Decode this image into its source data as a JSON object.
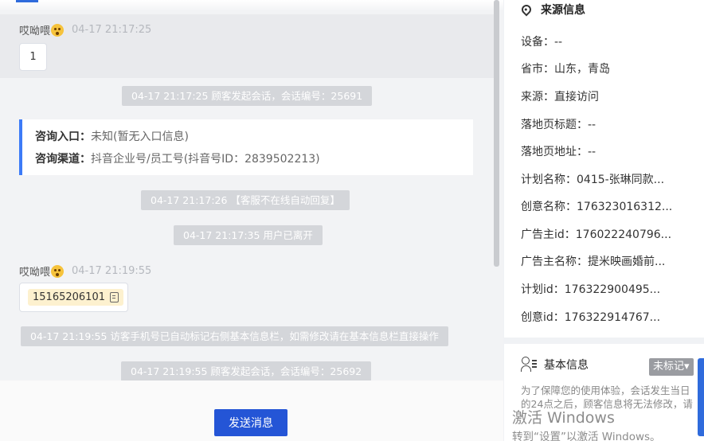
{
  "chat": {
    "messages": [
      {
        "sender": "哎呦喂",
        "time": "04-17 21:17:25",
        "content": "1"
      },
      {
        "sender": "哎呦喂",
        "time": "04-17 21:19:55",
        "content": "15165206101"
      }
    ],
    "system": [
      "04-17 21:17:25 顾客发起会话，会话编号：25691",
      "04-17 21:17:26 【客服不在线自动回复】",
      "04-17 21:17:35 用户已离开",
      "04-17 21:19:55 访客手机号已自动标记右侧基本信息栏，如需修改请在基本信息栏直接操作",
      "04-17 21:19:55 顾客发起会话，会话编号：25692"
    ],
    "consult": {
      "entry_label": "咨询入口：",
      "entry_value": "未知(暂无入口信息)",
      "channel_label": "咨询渠道：",
      "channel_value": "抖音企业号/员工号(抖音号ID：2839502213)"
    },
    "send_label": "发送消息"
  },
  "side": {
    "source_title": "来源信息",
    "fields": [
      "设备：--",
      "省市：山东，青岛",
      "来源：直接访问",
      "落地页标题：--",
      "落地页地址：--",
      "计划名称：0415-张琳同款...",
      "创意名称：176323016312...",
      "广告主id：176022240796...",
      "广告主名称：提米映画婚前...",
      "计划id：176322900495...",
      "创意id：176322914767..."
    ],
    "basic_title": "基本信息",
    "tag_label": "未标记▾",
    "notice": "为了保障您的使用体验，会话发生当日的24点之后，顾客信息将无法修改，请"
  },
  "watermark": {
    "line1": "激活 Windows",
    "line2": "转到“设置”以激活 Windows。"
  }
}
